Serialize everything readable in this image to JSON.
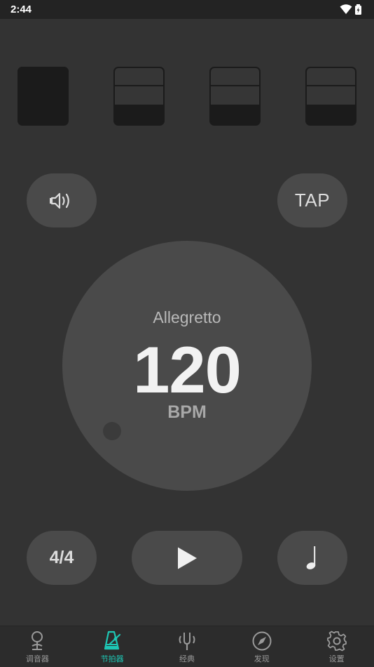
{
  "status_bar": {
    "time": "2:44"
  },
  "beats": [
    {
      "state": "accent"
    },
    {
      "state": "normal"
    },
    {
      "state": "normal"
    },
    {
      "state": "normal"
    }
  ],
  "controls": {
    "sound_icon": "speaker-icon",
    "tap_label": "TAP"
  },
  "tempo": {
    "name": "Allegretto",
    "bpm": "120",
    "unit": "BPM"
  },
  "bottom_controls": {
    "time_signature": "4/4",
    "play_icon": "play-icon",
    "note_icon": "quarter-note-icon"
  },
  "nav": {
    "active_color": "#1ec6b4",
    "items": [
      {
        "label": "调音器",
        "icon": "tuner-icon"
      },
      {
        "label": "节拍器",
        "icon": "metronome-icon"
      },
      {
        "label": "经典",
        "icon": "tuning-fork-icon"
      },
      {
        "label": "发现",
        "icon": "compass-icon"
      },
      {
        "label": "设置",
        "icon": "gear-icon"
      }
    ]
  }
}
